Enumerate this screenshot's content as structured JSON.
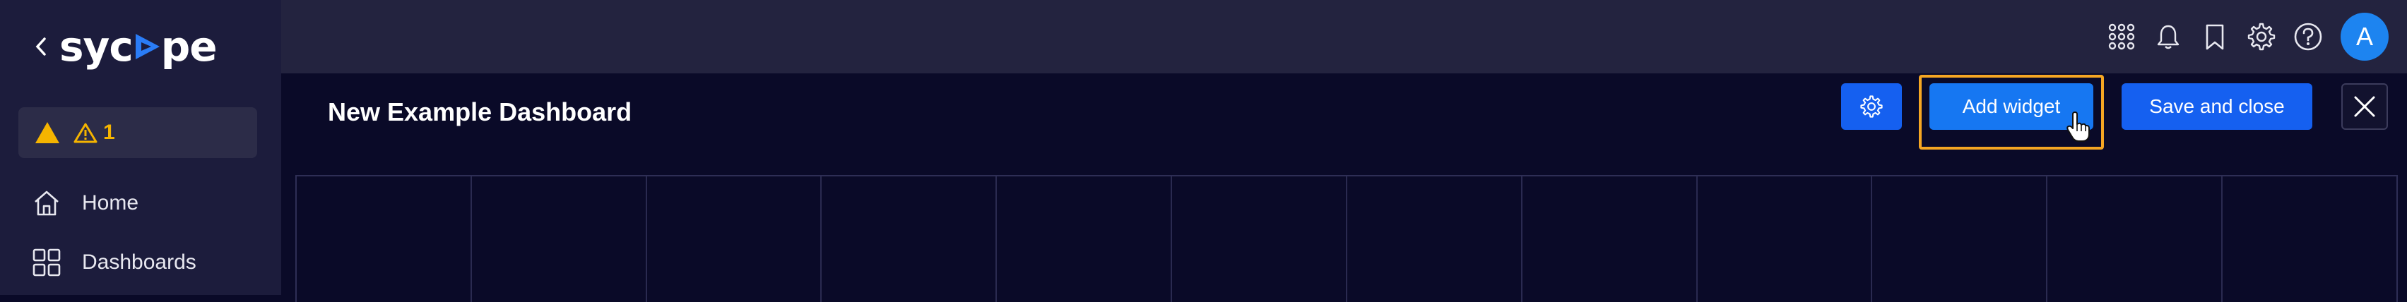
{
  "sidebar": {
    "logo_text": "sycope",
    "logo_prefix": "syc",
    "logo_suffix": "pe",
    "alert_count": "1",
    "nav": [
      {
        "label": "Home",
        "icon": "home-icon"
      },
      {
        "label": "Dashboards",
        "icon": "dashboards-icon"
      }
    ]
  },
  "topbar": {
    "icons": [
      "apps-grid-icon",
      "bell-icon",
      "bookmark-icon",
      "gear-icon",
      "help-icon"
    ],
    "avatar_initial": "A"
  },
  "dashboard": {
    "title": "New Example Dashboard",
    "add_widget_label": "Add widget",
    "save_close_label": "Save and close",
    "grid_columns": 12
  },
  "colors": {
    "background": "#0a0a28",
    "sidebar": "#1c1c3c",
    "topbar": "#23233f",
    "primary_button": "#1677f2",
    "highlight": "#f5a623",
    "warning": "#f5b400"
  }
}
